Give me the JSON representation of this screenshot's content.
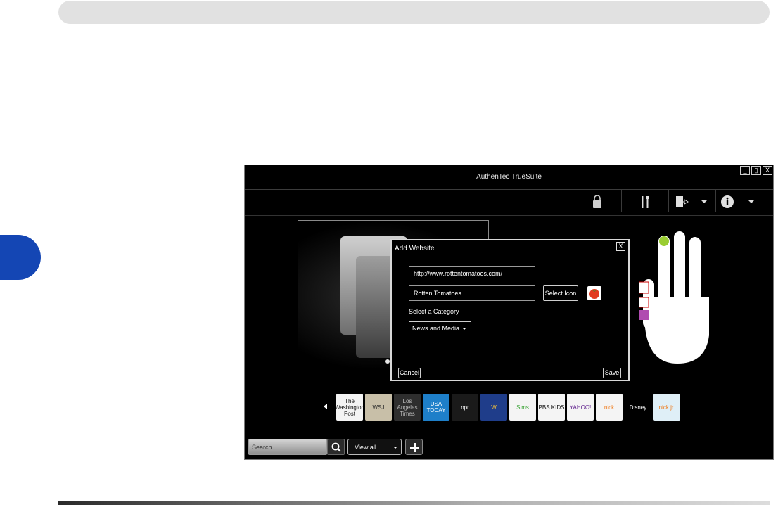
{
  "window": {
    "title": "AuthenTec TrueSuite",
    "minimize_label": "_",
    "maximize_label": "▯",
    "close_label": "X"
  },
  "dialog": {
    "title": "Add Website",
    "close_label": "X",
    "url_value": "http://www.rottentomatoes.com/",
    "name_value": "Rotten Tomatoes",
    "select_icon_label": "Select Icon",
    "category_label": "Select a Category",
    "category_value": "News and Media",
    "cancel_label": "Cancel",
    "save_label": "Save"
  },
  "favorites": [
    {
      "label": "The Washington Post",
      "bg": "#f4f4f4",
      "fg": "#111111"
    },
    {
      "label": "WSJ",
      "bg": "#c8bfa8",
      "fg": "#2b2b2b"
    },
    {
      "label": "Los Angeles Times",
      "bg": "#2e2e2e",
      "fg": "#bbbbbb"
    },
    {
      "label": "USA TODAY",
      "bg": "#1e7fc9",
      "fg": "#ffffff"
    },
    {
      "label": "npr",
      "bg": "#1a1a1a",
      "fg": "#ffffff"
    },
    {
      "label": "W",
      "bg": "#1f3d8a",
      "fg": "#f3c13a"
    },
    {
      "label": "Sims",
      "bg": "#f4f4f4",
      "fg": "#3aa335"
    },
    {
      "label": "PBS KIDS",
      "bg": "#f4f4f4",
      "fg": "#111111"
    },
    {
      "label": "YAHOO!",
      "bg": "#f4f4f4",
      "fg": "#5b1a8a"
    },
    {
      "label": "nick",
      "bg": "#f4f4f4",
      "fg": "#f07a1a"
    },
    {
      "label": "Disney",
      "bg": "#000000",
      "fg": "#ffffff"
    },
    {
      "label": "nick jr.",
      "bg": "#dfeff7",
      "fg": "#f07a1a"
    }
  ],
  "bottom_bar": {
    "search_placeholder": "Search",
    "view_value": "View all"
  },
  "colors": {
    "side_tab": "#1446b4",
    "app_background": "#000000",
    "finger_dot": "#9acd32"
  },
  "icons": {
    "lock": "lock-icon",
    "settings": "tools-icon",
    "logout": "logout-icon",
    "info": "info-icon",
    "search": "search-icon",
    "add": "plus-icon"
  }
}
